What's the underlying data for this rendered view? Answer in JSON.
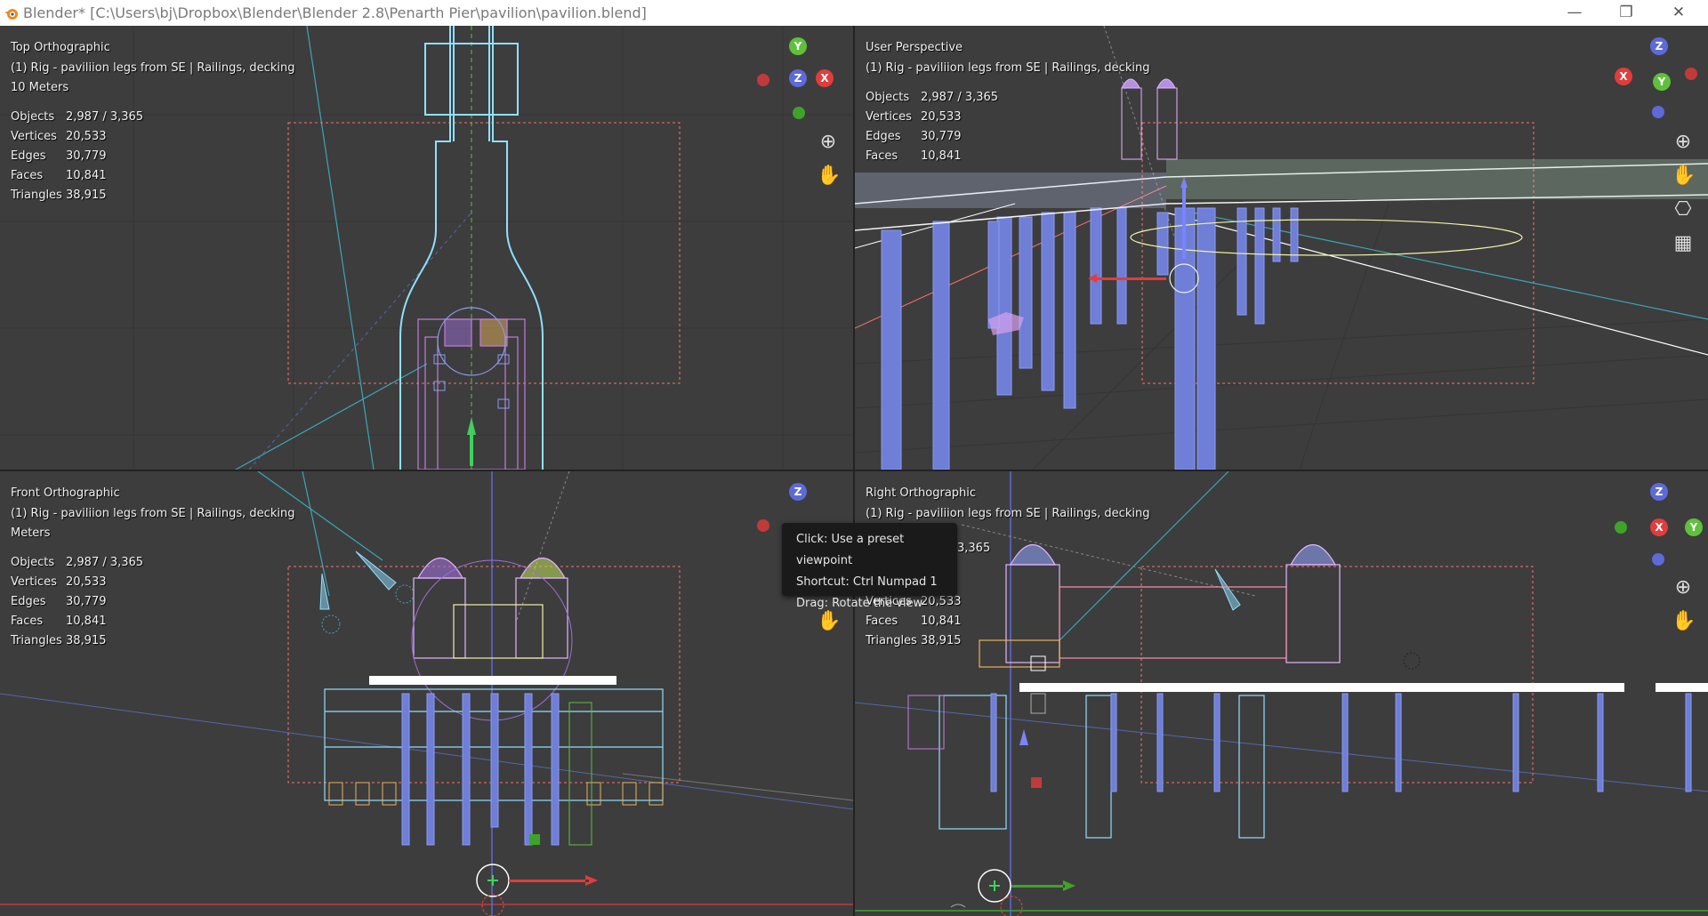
{
  "window": {
    "title": "Blender* [C:\\Users\\bj\\Dropbox\\Blender\\Blender 2.8\\Penarth Pier\\pavilion\\pavilion.blend]",
    "minimize": "—",
    "restore": "❐",
    "close": "✕"
  },
  "viewports": {
    "top_left": {
      "view_name": "Top Orthographic",
      "collection": "(1) Rig - paviliion legs from SE | Railings, decking",
      "scale": "10 Meters",
      "gizmo_axes": [
        "Y",
        "Z",
        "X"
      ]
    },
    "top_right": {
      "view_name": "User Perspective",
      "collection": "(1) Rig - paviliion legs from SE | Railings, decking",
      "gizmo_axes": [
        "Z",
        "X",
        "Y"
      ]
    },
    "bottom_left": {
      "view_name": "Front Orthographic",
      "collection": "(1) Rig - paviliion legs from SE | Railings, decking",
      "scale": "Meters",
      "gizmo_axes": [
        "Z"
      ]
    },
    "bottom_right": {
      "view_name": "Right Orthographic",
      "collection": "(1) Rig - paviliion legs from SE | Railings, decking",
      "gizmo_axes": [
        "Z",
        "X",
        "Y"
      ]
    }
  },
  "stats": {
    "objects_label": "Objects",
    "objects_value": "2,987 / 3,365",
    "vertices_label": "Vertices",
    "vertices_value": "20,533",
    "edges_label": "Edges",
    "edges_value": "30,779",
    "faces_label": "Faces",
    "faces_value": "10,841",
    "triangles_label": "Triangles",
    "triangles_value": "38,915"
  },
  "stats_partial": {
    "objects_value_fragment": "3,365"
  },
  "tooltip": {
    "line1": "Click: Use a preset viewpoint",
    "line2": "Shortcut: Ctrl Numpad 1",
    "line3": "Drag: Rotate the view"
  },
  "icons": [
    "zoom-icon",
    "hand-pan-icon",
    "camera-icon",
    "grid-icon",
    "blender-logo-icon"
  ],
  "colors": {
    "viewport_bg": "#3d3d3d",
    "axis_x": "#e23c3c",
    "axis_y": "#5fc13b",
    "axis_z": "#5d6ad8",
    "wire_cyan": "#8fe0ff",
    "wire_blue": "#8a9cf2",
    "selection_red": "#ff6e6e"
  }
}
